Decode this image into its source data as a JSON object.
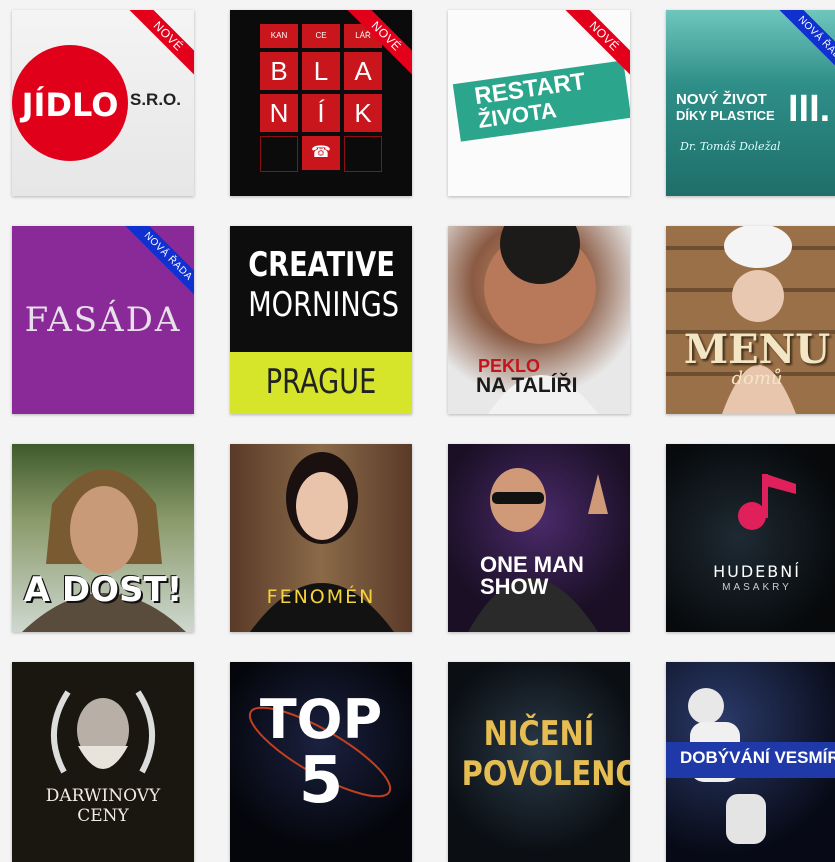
{
  "ribbons": {
    "new": "NOVÉ",
    "new_series": "NOVÁ ŘADA"
  },
  "tiles": {
    "jidlo": {
      "title": "JÍDLO",
      "suffix": "S.R.O."
    },
    "blanik": {
      "row1": [
        "KAN",
        "CE",
        "LÁŘ"
      ],
      "row2": [
        "B",
        "L",
        "A"
      ],
      "row3": [
        "N",
        "Í",
        "K"
      ]
    },
    "restart": {
      "line1": "RESTART",
      "line2": "ŽIVOTA"
    },
    "plastice": {
      "line1": "NOVÝ ŽIVOT",
      "line2": "DÍKY PLASTICE",
      "numeral": "III.",
      "author": "Dr. Tomáš Doležal"
    },
    "fasada": {
      "title": "FASÁDA"
    },
    "creative": {
      "line1": "CREATIVE",
      "line2": "MORNINGS",
      "city": "PRAGUE"
    },
    "peklo": {
      "line1": "PEKLO",
      "line2": "NA TALÍŘI"
    },
    "menu": {
      "title": "MENU",
      "subtitle": "domů"
    },
    "adost": {
      "title": "A DOST!"
    },
    "fenomen": {
      "title": "FENOMÉN"
    },
    "oneman": {
      "line1": "ONE MAN",
      "line2": "SHOW"
    },
    "hudebni": {
      "line1": "HUDEBNÍ",
      "line2": "MASAKRY"
    },
    "darwin": {
      "line1": "DARWINOVY",
      "line2": "CENY"
    },
    "top5": {
      "line1": "TOP",
      "line2": "5"
    },
    "niceni": {
      "line1": "NIČENÍ",
      "line2": "POVOLENO"
    },
    "vesmir": {
      "title": "DOBÝVÁNÍ VESMÍRU"
    }
  }
}
